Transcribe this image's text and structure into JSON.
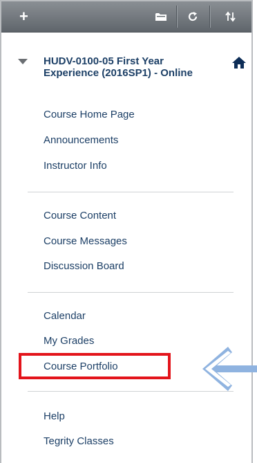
{
  "toolbar": {
    "add_label": "+",
    "icons": [
      "folder-icon",
      "refresh-icon",
      "sort-icon"
    ]
  },
  "course": {
    "title": "HUDV-0100-05 First Year Experience (2016SP1) - Online"
  },
  "menu": {
    "group1": [
      "Course Home Page",
      "Announcements",
      "Instructor Info"
    ],
    "group2": [
      "Course Content",
      "Course Messages",
      "Discussion Board"
    ],
    "group3": [
      "Calendar",
      "My Grades",
      "Course Portfolio"
    ],
    "group4": [
      "Help",
      "Tegrity Classes"
    ]
  },
  "colors": {
    "link": "#1c3f66",
    "highlight": "#e3141b",
    "arrow": "#8fb3e0"
  }
}
